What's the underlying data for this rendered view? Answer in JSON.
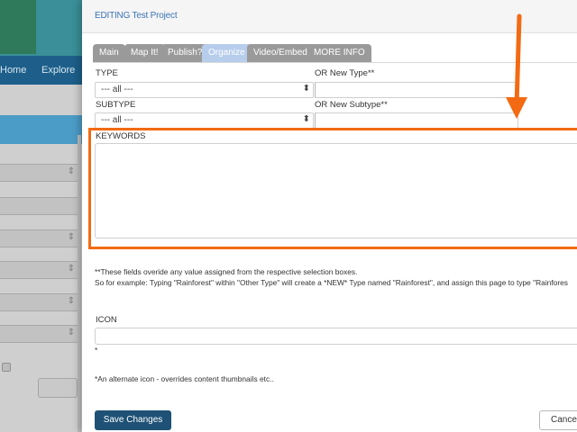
{
  "background": {
    "nav": [
      "Home",
      "Explore"
    ]
  },
  "modal": {
    "title": "EDITING Test Project"
  },
  "tabs": [
    {
      "label": "Main",
      "active": false
    },
    {
      "label": "Map It!",
      "active": false
    },
    {
      "label": "Publish?",
      "active": false
    },
    {
      "label": "Organize",
      "active": true
    },
    {
      "label": "Video/Embed",
      "active": false
    },
    {
      "label": "MORE INFO",
      "active": false
    }
  ],
  "form": {
    "type_label": "TYPE",
    "type_value": "--- all ---",
    "new_type_label": "OR New Type**",
    "subtype_label": "SUBTYPE",
    "subtype_value": "--- all ---",
    "new_subtype_label": "OR New Subtype**",
    "keywords_label": "KEYWORDS",
    "note_line1": "**These fields overide any value assigned from the respective selection boxes.",
    "note_line2": "So for example: Typing \"Rainforest\" within \"Other Type\" will create a *NEW* Type named \"Rainforest\", and assign this page to type \"Rainfores",
    "icon_label": "ICON",
    "icon_asterisk": "*",
    "icon_note": "*An alternate icon - overrides content thumbnails etc.."
  },
  "buttons": {
    "save": "Save Changes",
    "cancel": "Cancel"
  },
  "colors": {
    "highlight": "#f36a12",
    "title_blue": "#3b74b3",
    "save_bg": "#1e5175",
    "tab_active": "#b7cdec",
    "tab_inactive": "#9a9a9a"
  },
  "icons": {
    "select_arrow": "up-down-arrows-icon",
    "annotation": "orange-arrow-icon"
  }
}
